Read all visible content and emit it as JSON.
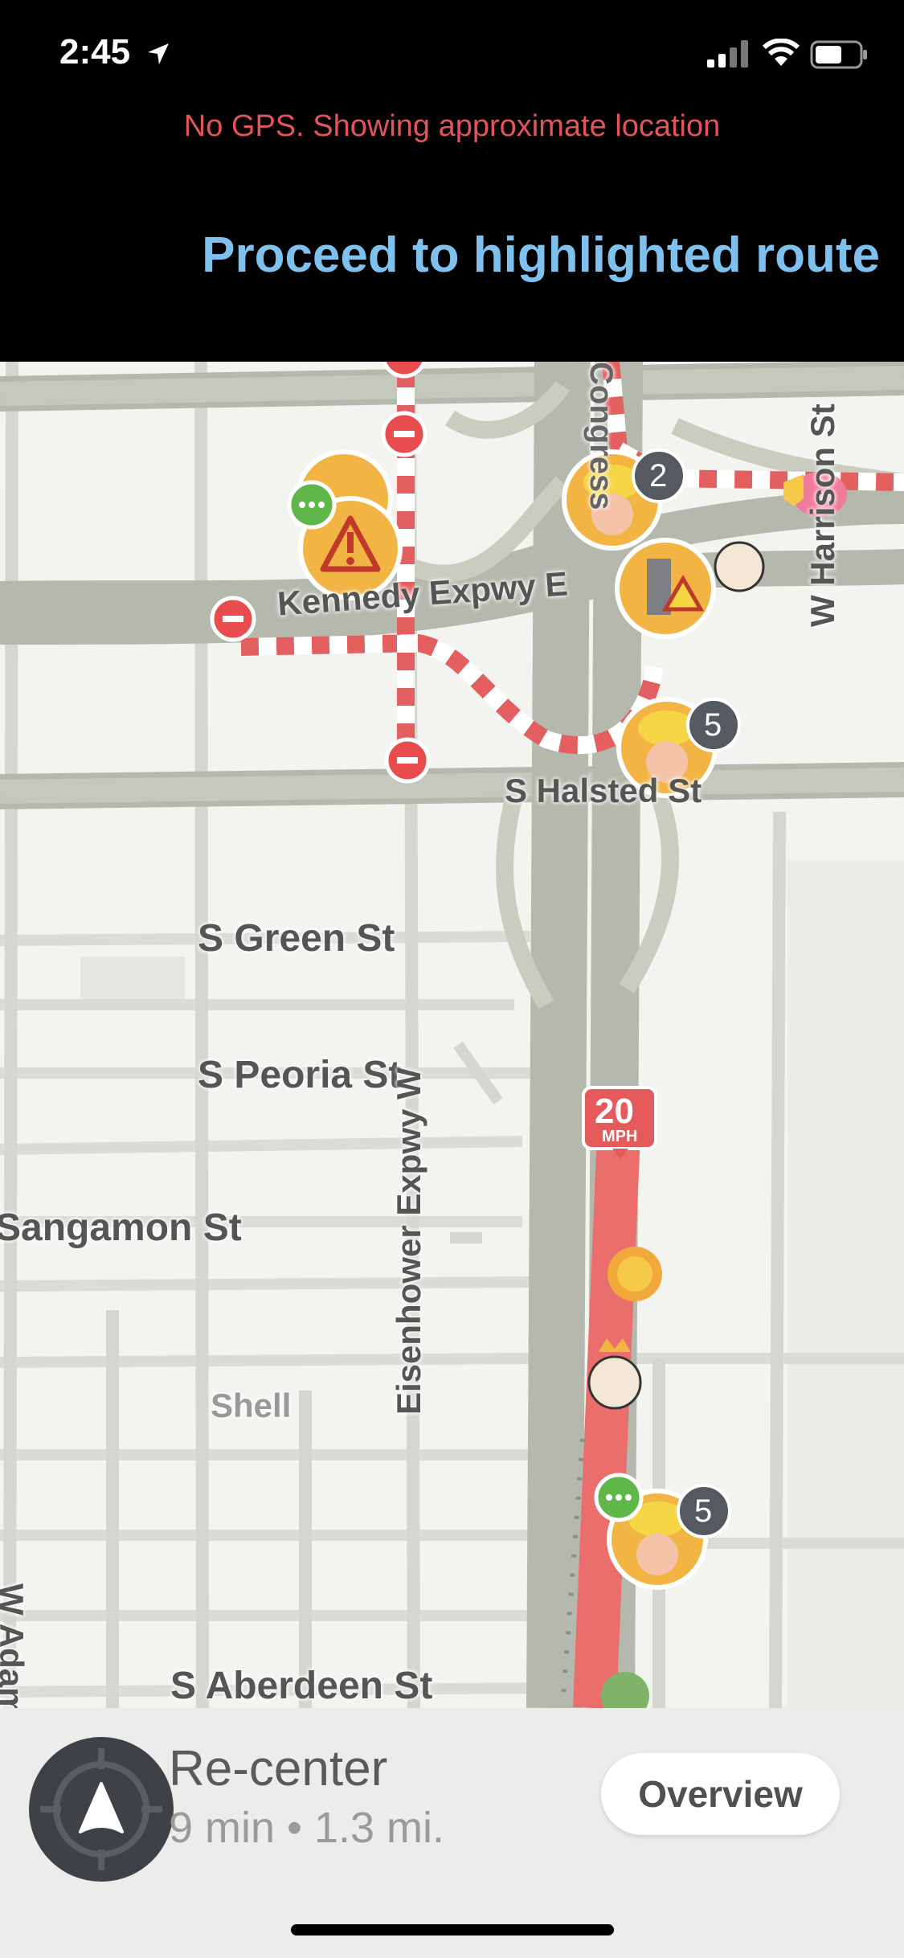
{
  "status_bar": {
    "time": "2:45"
  },
  "banner": {
    "gps_warning": "No GPS. Showing approximate location",
    "instruction": "Proceed to highlighted route"
  },
  "map": {
    "streets": {
      "kennedy": "Kennedy Expwy E",
      "halsted": "S Halsted St",
      "green": "S Green St",
      "peoria": "S Peoria St",
      "sangamon": "Sangamon St",
      "eisenhower": "Eisenhower Expwy W",
      "harrison": "W Harrison St",
      "adams": "W Adams",
      "aberdeen": "S Aberdeen St",
      "congress": "Congress"
    },
    "poi": {
      "shell": "Shell"
    },
    "speed_limit": {
      "value": "20",
      "unit": "MPH"
    },
    "report_counts": {
      "top": "2",
      "middle": "5",
      "bottom": "5"
    }
  },
  "bottom_bar": {
    "title": "Re-center",
    "subtitle": "9 min • 1.3 mi.",
    "overview_label": "Overview"
  }
}
